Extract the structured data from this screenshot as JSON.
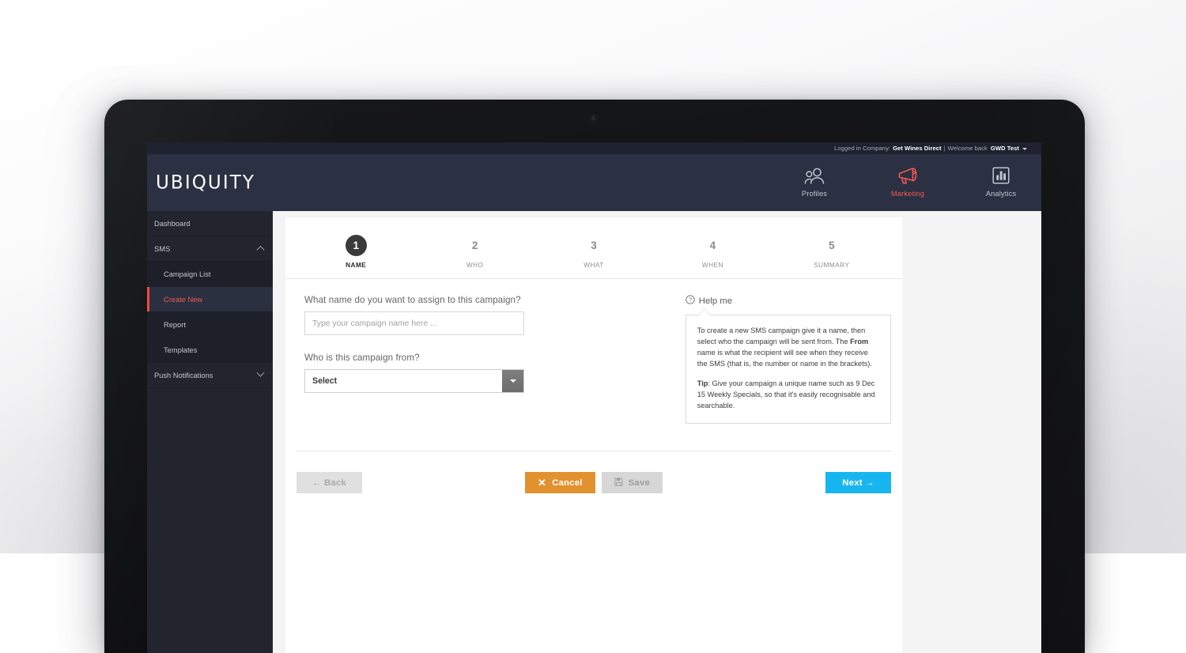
{
  "topbar": {
    "logged_in_prefix": "Logged in Company:",
    "company": "Get Wines Direct",
    "separator": "|",
    "welcome_prefix": "Welcome back",
    "user": "GWD Test"
  },
  "header": {
    "logo": "UBIQUITY",
    "nav": [
      {
        "label": "Profiles",
        "icon": "people-icon",
        "active": false
      },
      {
        "label": "Marketing",
        "icon": "megaphone-icon",
        "active": true
      },
      {
        "label": "Analytics",
        "icon": "bar-chart-icon",
        "active": false
      }
    ]
  },
  "sidebar": {
    "items": [
      {
        "label": "Dashboard",
        "sub": false,
        "active": false,
        "chevron": ""
      },
      {
        "label": "SMS",
        "sub": false,
        "active": false,
        "chevron": "up"
      },
      {
        "label": "Campaign List",
        "sub": true,
        "active": false,
        "chevron": ""
      },
      {
        "label": "Create New",
        "sub": true,
        "active": true,
        "chevron": ""
      },
      {
        "label": "Report",
        "sub": true,
        "active": false,
        "chevron": ""
      },
      {
        "label": "Templates",
        "sub": true,
        "active": false,
        "chevron": ""
      },
      {
        "label": "Push Notifications",
        "sub": false,
        "active": false,
        "chevron": "down"
      }
    ]
  },
  "wizard": {
    "steps": [
      {
        "number": "1",
        "label": "NAME",
        "active": true
      },
      {
        "number": "2",
        "label": "WHO",
        "active": false
      },
      {
        "number": "3",
        "label": "WHAT",
        "active": false
      },
      {
        "number": "4",
        "label": "WHEN",
        "active": false
      },
      {
        "number": "5",
        "label": "SUMMARY",
        "active": false
      }
    ]
  },
  "form": {
    "name_label": "What name do you want to assign to this campaign?",
    "name_value": "",
    "name_placeholder": "Type your campaign name here ...",
    "from_label": "Who is this campaign from?",
    "from_value": "Select",
    "from_options": [
      "Select"
    ]
  },
  "help": {
    "title": "Help me",
    "icon": "question-circle-icon",
    "paragraph1_part1": "To create a new SMS campaign give it a name, then select who the campaign will be sent from. The ",
    "paragraph1_bold": "From",
    "paragraph1_part2": " name is what the recipient will see when they receive the SMS (that is, the number or name in the brackets).",
    "paragraph2_bold": "Tip",
    "paragraph2_text": ": Give your campaign a unique name such as 9 Dec 15 Weekly Specials, so that it's easily recognisable and searchable."
  },
  "footer": {
    "back": "← Back",
    "cancel": "Cancel",
    "cancel_icon": "close-x-icon",
    "save": "Save",
    "save_icon": "floppy-disk-icon",
    "next": "Next →"
  },
  "colors": {
    "accent_red": "#ef5a50",
    "orange": "#e2912f",
    "blue": "#18b6f0",
    "header_dark": "#2b3042",
    "sidebar_dark": "#22252e",
    "topbar_dark": "#1e222e"
  }
}
